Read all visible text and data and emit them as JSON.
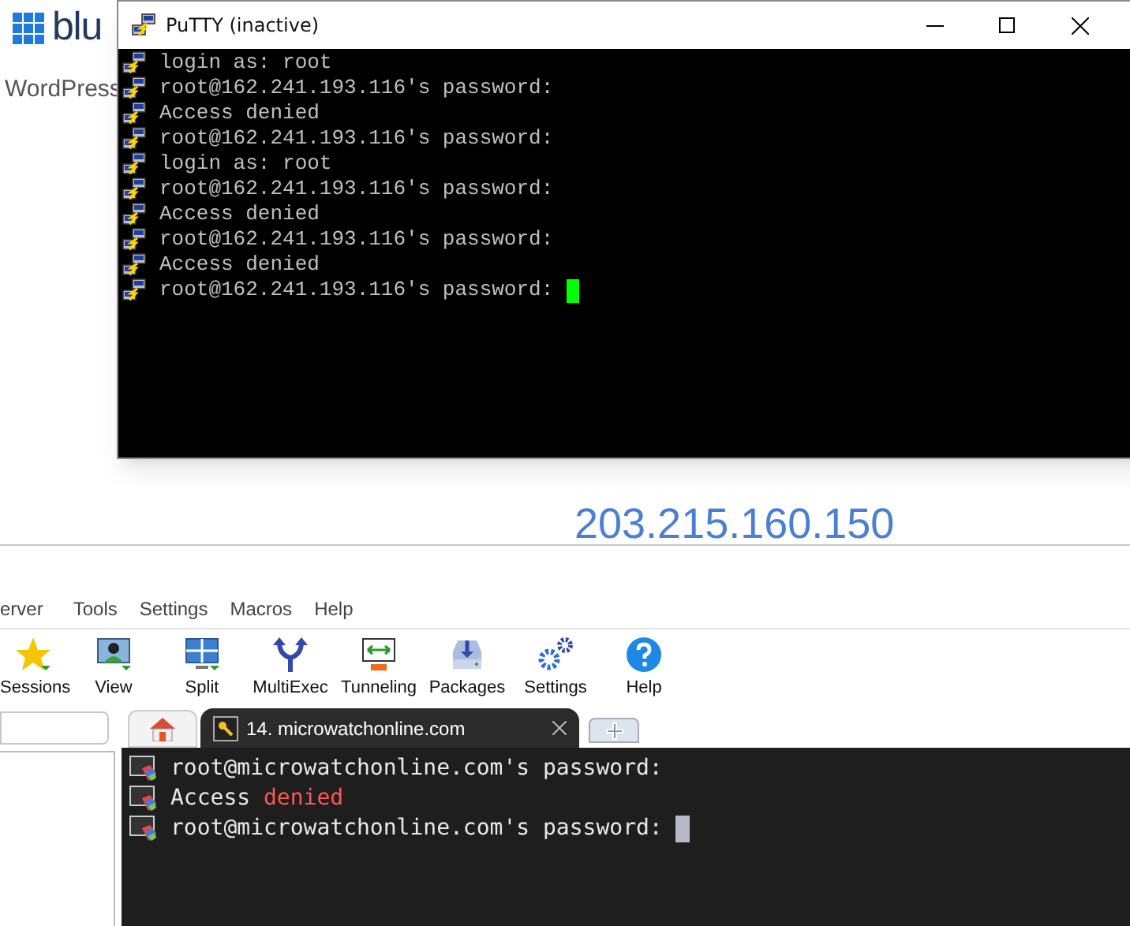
{
  "background_page": {
    "logo_text": "blu",
    "subtitle": "WordPress",
    "ip_address": "203.215.160.150"
  },
  "putty_window": {
    "title": "PuTTY (inactive)",
    "lines": [
      {
        "text": "login as: root"
      },
      {
        "text": "root@162.241.193.116's password:"
      },
      {
        "text": "Access denied"
      },
      {
        "text": "root@162.241.193.116's password:"
      },
      {
        "text": "login as: root"
      },
      {
        "text": "root@162.241.193.116's password:"
      },
      {
        "text": "Access denied"
      },
      {
        "text": "root@162.241.193.116's password:"
      },
      {
        "text": "Access denied"
      },
      {
        "text": "root@162.241.193.116's password:",
        "cursor": true
      }
    ]
  },
  "moba_window": {
    "menu": [
      "erver",
      "Tools",
      "Settings",
      "Macros",
      "Help"
    ],
    "toolbar": [
      {
        "kind": "star",
        "label": "Sessions"
      },
      {
        "kind": "monitor",
        "label": "View"
      },
      {
        "kind": "split",
        "label": "Split"
      },
      {
        "kind": "fork",
        "label": "MultiExec"
      },
      {
        "kind": "tunnel",
        "label": "Tunneling"
      },
      {
        "kind": "package",
        "label": "Packages"
      },
      {
        "kind": "gears",
        "label": "Settings"
      },
      {
        "kind": "help",
        "label": "Help"
      }
    ],
    "tabs": [
      {
        "kind": "home",
        "selected": false
      },
      {
        "kind": "session",
        "label": "14. microwatchonline.com",
        "selected": true
      },
      {
        "kind": "new",
        "selected": false
      }
    ],
    "terminal_lines": [
      {
        "segments": [
          {
            "kind": "plain",
            "text": "root@microwatchonline.com's password:"
          }
        ]
      },
      {
        "segments": [
          {
            "kind": "plain",
            "text": "Access"
          },
          {
            "kind": "error",
            "text": "denied"
          }
        ]
      },
      {
        "segments": [
          {
            "kind": "plain",
            "text": "root@microwatchonline.com's password:"
          }
        ],
        "cursor": true
      }
    ]
  }
}
